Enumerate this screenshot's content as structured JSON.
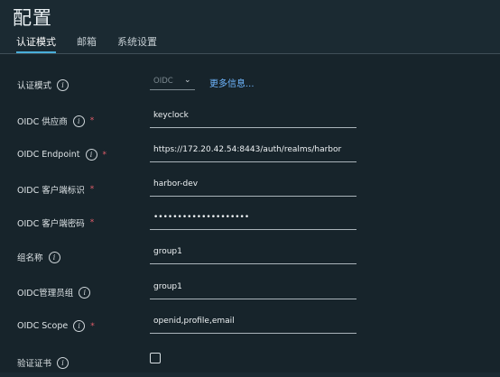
{
  "page": {
    "title": "配置",
    "tabs": [
      {
        "label": "认证模式",
        "active": true
      },
      {
        "label": "邮箱",
        "active": false
      },
      {
        "label": "系统设置",
        "active": false
      }
    ]
  },
  "form": {
    "auth_mode": {
      "label": "认证模式",
      "value": "OIDC",
      "more_link": "更多信息..."
    },
    "oidc_provider": {
      "label": "OIDC 供应商",
      "required_mark": "*",
      "value": "keyclock"
    },
    "oidc_endpoint": {
      "label": "OIDC Endpoint",
      "required_mark": "*",
      "value": "https://172.20.42.54:8443/auth/realms/harbor"
    },
    "oidc_client_id": {
      "label": "OIDC 客户端标识",
      "required_mark": "*",
      "value": "harbor-dev"
    },
    "oidc_client_secret": {
      "label": "OIDC 客户端密码",
      "required_mark": "*",
      "value": "••••••••••••••••••••"
    },
    "group_name": {
      "label": "组名称",
      "value": "group1"
    },
    "oidc_admin_group": {
      "label": "OIDC管理员组",
      "value": "group1"
    },
    "oidc_scope": {
      "label": "OIDC Scope",
      "required_mark": "*",
      "value": "openid,profile,email"
    },
    "verify_cert": {
      "label": "验证证书",
      "checked": false
    }
  },
  "icons": {
    "info": "info-circle-icon",
    "select": "chevron-down-icon"
  },
  "colors": {
    "background": "#17242b",
    "header": "#1b2a32",
    "accent": "#49aeda",
    "link": "#6fb6ff",
    "required": "#e35d6a"
  }
}
